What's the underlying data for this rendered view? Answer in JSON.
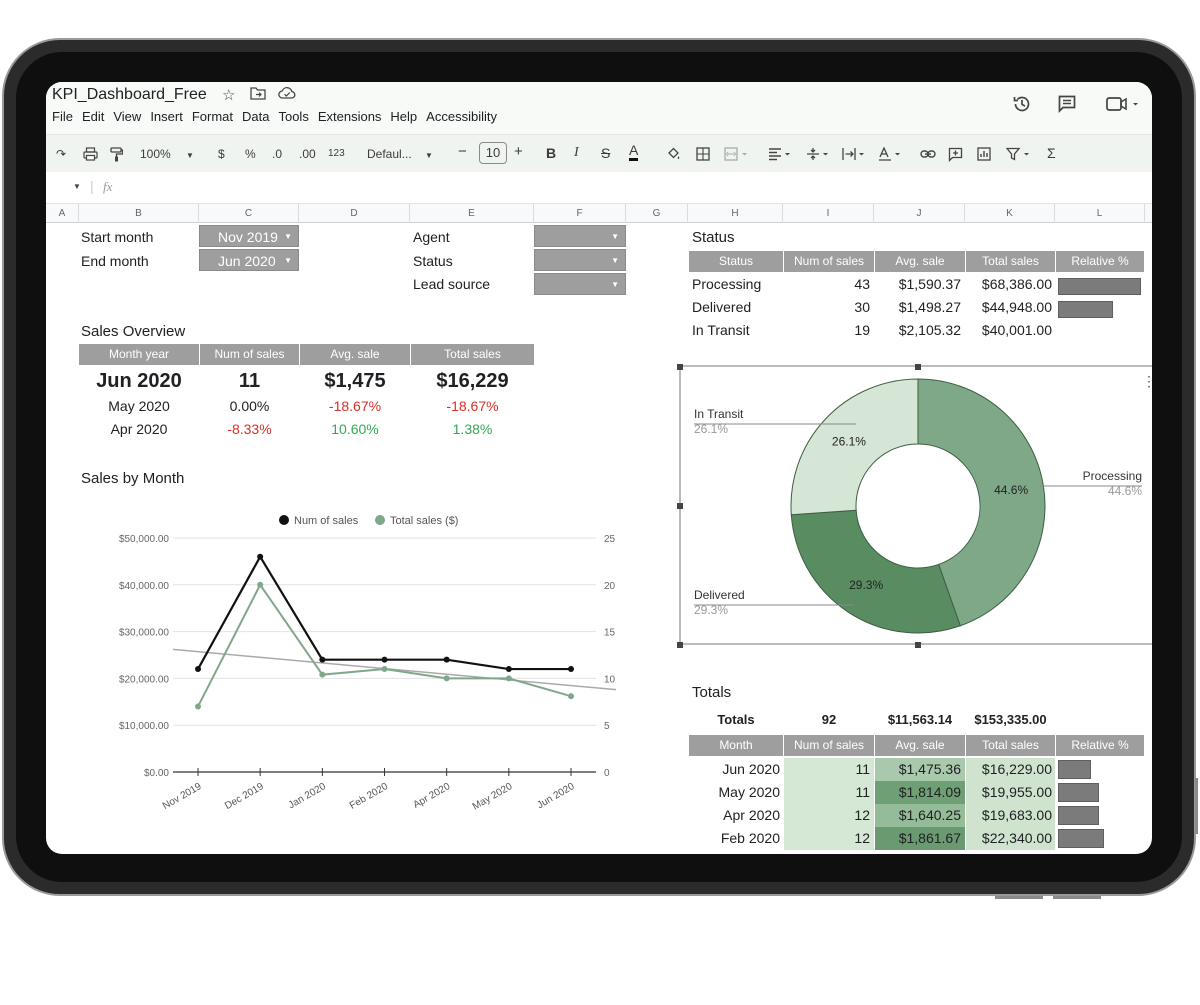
{
  "doc": {
    "title": "KPI_Dashboard_Free",
    "menu": [
      "File",
      "Edit",
      "View",
      "Insert",
      "Format",
      "Data",
      "Tools",
      "Extensions",
      "Help",
      "Accessibility"
    ]
  },
  "toolbar": {
    "zoom": "100%",
    "currency": "$",
    "percent": "%",
    "dec_decrease": ".0",
    "dec_increase": ".00",
    "number_format": "123",
    "font": "Defaul...",
    "minus": "−",
    "font_size": "10",
    "plus": "+",
    "bold": "B",
    "italic": "I",
    "strike": "S",
    "text_color": "A",
    "sigma": "Σ"
  },
  "formula": {
    "fx": "fx"
  },
  "columns": [
    "A",
    "B",
    "C",
    "D",
    "E",
    "F",
    "G",
    "H",
    "I",
    "J",
    "K",
    "L"
  ],
  "filters": {
    "start_label": "Start month",
    "start_value": "Nov 2019",
    "end_label": "End month",
    "end_value": "Jun 2020",
    "agent_label": "Agent",
    "status_label": "Status",
    "lead_label": "Lead source"
  },
  "sales_overview": {
    "title": "Sales Overview",
    "headers": [
      "Month year",
      "Num of sales",
      "Avg. sale",
      "Total sales"
    ],
    "main": [
      "Jun 2020",
      "11",
      "$1,475",
      "$16,229"
    ],
    "rows": [
      [
        "May 2020",
        "0.00%",
        "-18.67%",
        "-18.67%"
      ],
      [
        "Apr 2020",
        "-8.33%",
        "10.60%",
        "1.38%"
      ]
    ]
  },
  "status_table": {
    "title": "Status",
    "headers": [
      "Status",
      "Num of sales",
      "Avg. sale",
      "Total sales",
      "Relative %"
    ],
    "rows": [
      {
        "status": "Processing",
        "num": "43",
        "avg": "$1,590.37",
        "total": "$68,386.00",
        "rel": 1.0
      },
      {
        "status": "Delivered",
        "num": "30",
        "avg": "$1,498.27",
        "total": "$44,948.00",
        "rel": 0.657
      },
      {
        "status": "In Transit",
        "num": "19",
        "avg": "$2,105.32",
        "total": "$40,001.00",
        "rel": 0
      }
    ]
  },
  "sales_by_month": {
    "title": "Sales by Month"
  },
  "donut_labels": {
    "in_transit": "In Transit",
    "in_transit_pct": "26.1%",
    "delivered": "Delivered",
    "delivered_pct": "29.3%",
    "processing": "Processing",
    "processing_pct": "44.6%"
  },
  "totals": {
    "title": "Totals",
    "summary": [
      "Totals",
      "92",
      "$11,563.14",
      "$153,335.00"
    ],
    "headers": [
      "Month",
      "Num of sales",
      "Avg. sale",
      "Total sales",
      "Relative %"
    ],
    "rows": [
      {
        "month": "Jun 2020",
        "num": "11",
        "avg": "$1,475.36",
        "total": "$16,229.00",
        "rel": 0.727
      },
      {
        "month": "May 2020",
        "num": "11",
        "avg": "$1,814.09",
        "total": "$19,955.00",
        "rel": 0.893
      },
      {
        "month": "Apr 2020",
        "num": "12",
        "avg": "$1,640.25",
        "total": "$19,683.00",
        "rel": 0.881
      },
      {
        "month": "Feb 2020",
        "num": "12",
        "avg": "$1,861.67",
        "total": "$22,340.00",
        "rel": 1.0
      }
    ]
  },
  "chart_data": [
    {
      "type": "line",
      "title": "",
      "categories": [
        "Nov 2019",
        "Dec 2019",
        "Jan 2020",
        "Feb 2020",
        "Apr 2020",
        "May 2020",
        "Jun 2020"
      ],
      "series": [
        {
          "name": "Num of sales",
          "axis": "right",
          "color": "#111111",
          "values": [
            11,
            23,
            12,
            12,
            12,
            11,
            11
          ]
        },
        {
          "name": "Total sales ($)",
          "axis": "left",
          "color": "#7fa88a",
          "values": [
            14000,
            40000,
            20800,
            22000,
            20000,
            20000,
            16200
          ]
        }
      ],
      "trendline": {
        "color": "#aaaaaa",
        "from": 26200,
        "to": 17600
      },
      "y_left": {
        "ticks": [
          "$0.00",
          "$10,000.00",
          "$20,000.00",
          "$30,000.00",
          "$40,000.00",
          "$50,000.00"
        ],
        "range": [
          0,
          50000
        ]
      },
      "y_right": {
        "ticks": [
          "0",
          "5",
          "10",
          "15",
          "20",
          "25"
        ],
        "range": [
          0,
          25
        ]
      },
      "legend": "top",
      "grid": true
    },
    {
      "type": "pie",
      "title": "",
      "donut": true,
      "categories": [
        "Processing",
        "Delivered",
        "In Transit"
      ],
      "values": [
        44.6,
        29.3,
        26.1
      ],
      "colors": [
        "#7ea887",
        "#5a8c62",
        "#d6e6d6"
      ]
    }
  ]
}
